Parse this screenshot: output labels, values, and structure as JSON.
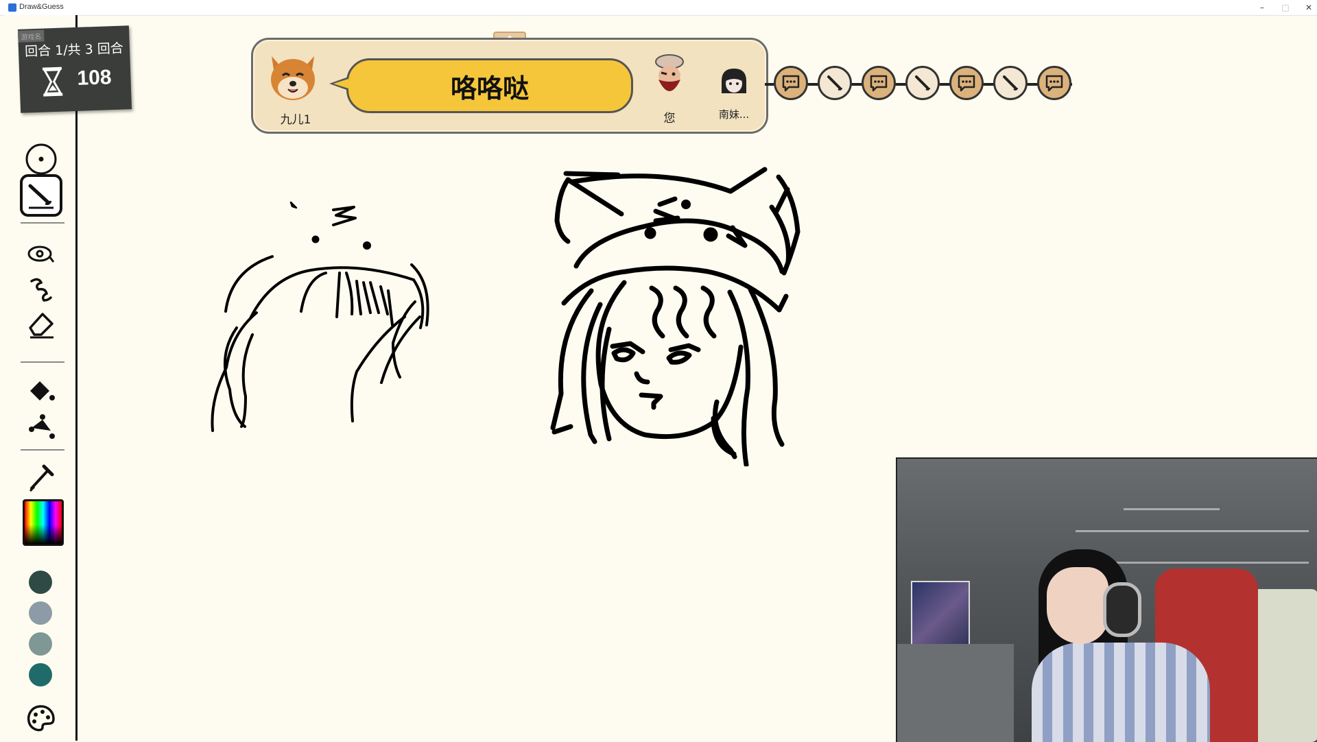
{
  "window": {
    "title": "Draw&Guess",
    "controls": [
      "–",
      "□",
      "✕"
    ]
  },
  "round": {
    "tag": "游戏名",
    "label": "回合 1/共 3 回合",
    "timer": "108"
  },
  "panel": {
    "drawer_name": "九儿1",
    "guess_text": "咯咯哒",
    "you_label": "您",
    "player3_name": "南妹..."
  },
  "turn_sequence": [
    "chat",
    "draw",
    "chat",
    "draw",
    "chat",
    "draw",
    "chat"
  ],
  "tools": {
    "items": [
      "brush-size",
      "brush",
      "lasso",
      "smudge",
      "eraser",
      "bucket",
      "shape",
      "eyedropper",
      "color-gradient",
      "palette"
    ],
    "swatches": [
      "#2f4a44",
      "#8d9ba6",
      "#7f9895",
      "#1f6b6a"
    ]
  },
  "colors": {
    "background": "#fefcf0",
    "panel": "#f2e2c0",
    "bubble": "#f5c63a",
    "round_card": "#3a3d3a"
  }
}
